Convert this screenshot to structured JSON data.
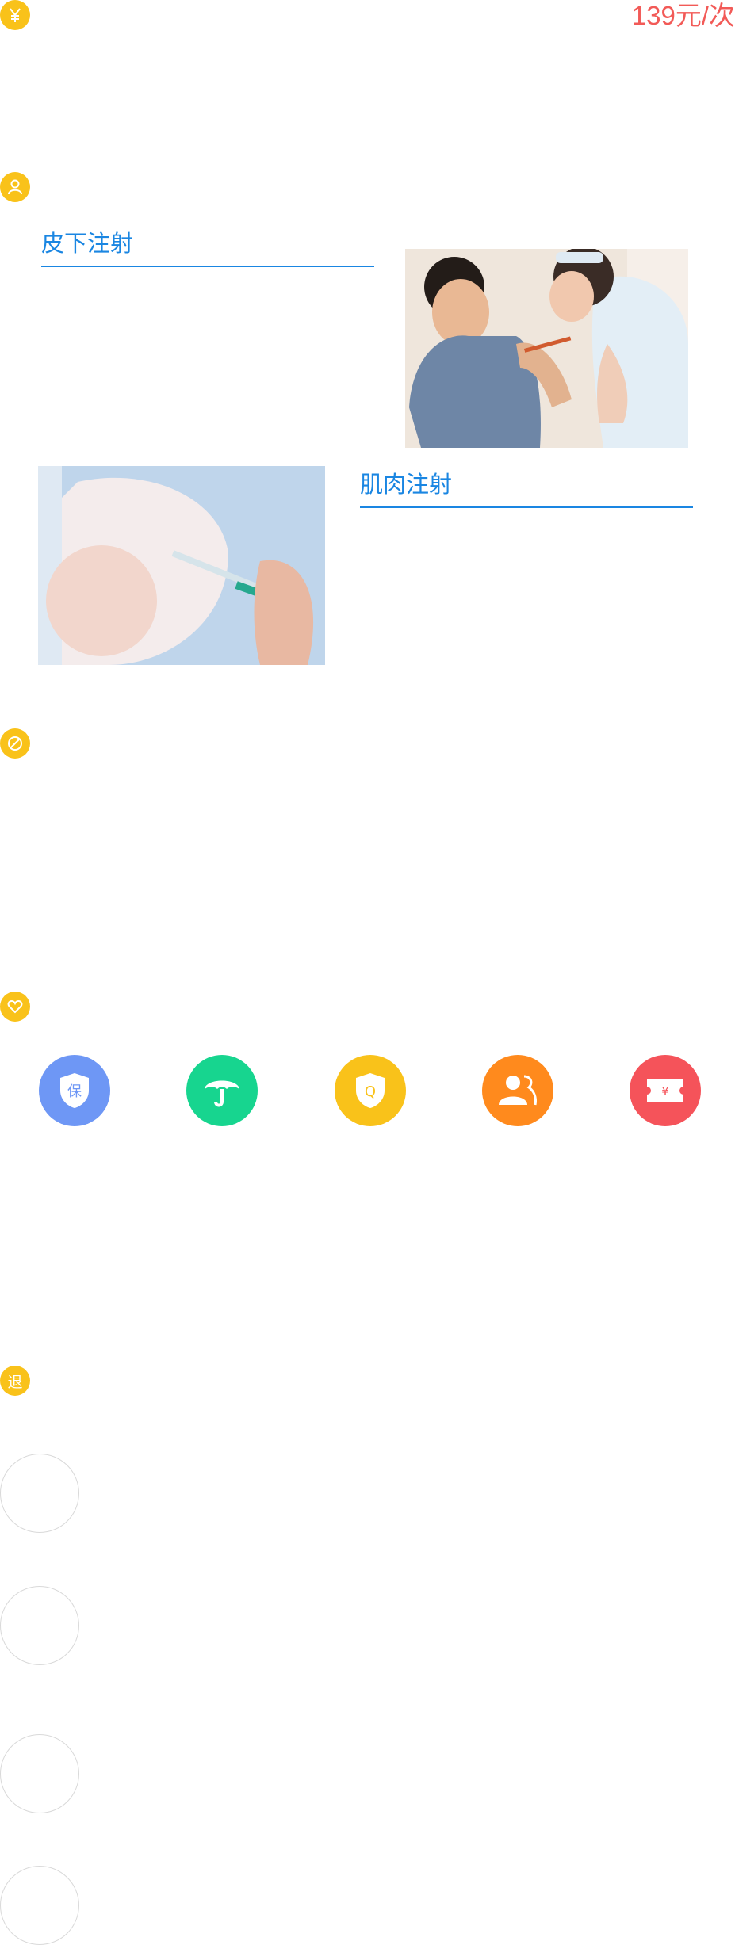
{
  "price": {
    "amount": "139",
    "unit": "元/次"
  },
  "section_icons": {
    "price": "yen-icon",
    "person": "person-icon",
    "ban": "ban-icon",
    "service": "heart-icon",
    "refund": "退"
  },
  "injections": [
    {
      "label": "皮下注射",
      "image": "child-vaccination-photo"
    },
    {
      "label": "肌肉注射",
      "image": "infant-thigh-injection-photo"
    }
  ],
  "services": [
    {
      "icon": "shield-bao-icon",
      "glyph": "保",
      "color": "#6e97f5"
    },
    {
      "icon": "umbrella-icon",
      "color": "#17d58f"
    },
    {
      "icon": "shield-q-icon",
      "glyph": "Q",
      "color": "#f9c21a"
    },
    {
      "icon": "people-icon",
      "color": "#ff8a1d"
    },
    {
      "icon": "ticket-yen-icon",
      "glyph": "¥",
      "color": "#f5535a"
    }
  ],
  "refund_items": [
    "circle-1",
    "circle-2",
    "circle-3",
    "circle-4"
  ]
}
